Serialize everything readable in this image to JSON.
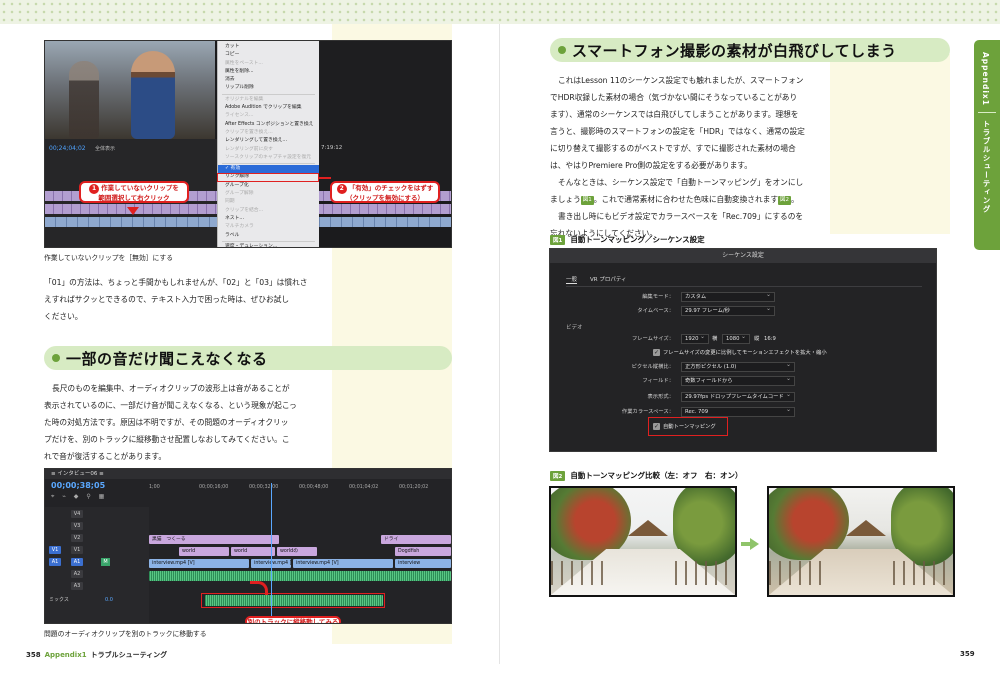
{
  "left": {
    "screenshot1": {
      "timecode": "00;24;04;02",
      "fit_label": "全体表示",
      "right_timecode": "7:19:12",
      "context_menu": [
        {
          "label": "カット",
          "state": "normal"
        },
        {
          "label": "コピー",
          "state": "normal"
        },
        {
          "label": "属性をペースト...",
          "state": "dim"
        },
        {
          "label": "属性を削除...",
          "state": "normal"
        },
        {
          "label": "消去",
          "state": "normal"
        },
        {
          "label": "リップル削除",
          "state": "normal"
        },
        {
          "label": "",
          "state": "sep"
        },
        {
          "label": "オリジナルを編集",
          "state": "dim"
        },
        {
          "label": "Adobe Audition でクリップを編集",
          "state": "normal"
        },
        {
          "label": "ライセンス...",
          "state": "dim"
        },
        {
          "label": "After Effects コンポジションと置き換え",
          "state": "normal"
        },
        {
          "label": "クリップを置き換え...",
          "state": "dim"
        },
        {
          "label": "レンダリングして置き換え...",
          "state": "normal"
        },
        {
          "label": "レンダリング前に戻す",
          "state": "dim"
        },
        {
          "label": "ソースクリップのキャプチャ設定を復元",
          "state": "dim"
        },
        {
          "label": "",
          "state": "sep"
        },
        {
          "label": "✓ 有効",
          "state": "hl"
        },
        {
          "label": "リンク解除",
          "state": "normal"
        },
        {
          "label": "グループ化",
          "state": "normal"
        },
        {
          "label": "グループ解除",
          "state": "dim"
        },
        {
          "label": "同期",
          "state": "dim"
        },
        {
          "label": "クリップを結合...",
          "state": "dim"
        },
        {
          "label": "ネスト...",
          "state": "normal"
        },
        {
          "label": "マルチカメラ",
          "state": "dim"
        },
        {
          "label": "ラベル",
          "state": "normal"
        },
        {
          "label": "",
          "state": "sep"
        },
        {
          "label": "速度・デュレーション...",
          "state": "normal"
        }
      ],
      "callout1_num": "1",
      "callout1_text": "作業していないクリップを\n範囲選択して右クリック",
      "callout2_num": "2",
      "callout2_text": "「有効」のチェックをはずす\n（クリップを無効にする）"
    },
    "caption1": "作業していないクリップを［無効］にする",
    "para1": [
      "「01」の方法は、ちょっと手間かもしれませんが、「02」と「03」は慣れさ",
      "えすればサクッとできるので、テキスト入力で困った時は、ぜひお試し",
      "ください。"
    ],
    "heading2": "一部の音だけ聞こえなくなる",
    "para2": [
      "長尺のものを編集中、オーディオクリップの波形上は音があることが",
      "表示されているのに、一部だけ音が聞こえなくなる、という現象が起こっ",
      "た時の対処方法です。原因は不明ですが、その問題のオーディオクリッ",
      "プだけを、別のトラックに縦移動させ配置しなおしてみてください。こ",
      "れで音が復活することがあります。"
    ],
    "screenshot2": {
      "tab": "≡ インタビュー06 ≡",
      "timecode": "00;00;38;05",
      "ruler": [
        "1;00",
        "00;00;16;00",
        "00;00;32;00",
        "00;00;48;00",
        "00;01;04;02",
        "00;01;20;02"
      ],
      "tracks": [
        "V4",
        "V3",
        "V2",
        "V1",
        "A1",
        "A2",
        "A3",
        "ミックス"
      ],
      "mix_value": "0.0",
      "clip_title": "黒猫　つくーる",
      "clip_title2": "ドライ",
      "clips_v2": [
        "world",
        "world",
        "worldの",
        "Dogdfish"
      ],
      "clip_v1": "interview.mp4 [V]",
      "clip_v1b": "interview.mp4 [V]",
      "clip_v1c": "interview.mp4 [V]",
      "clip_v1d": "interview",
      "callout": "別のトラックに縦移動してみる"
    },
    "caption2": "問題のオーディオクリップを別のトラックに移動する",
    "folio_num": "358",
    "folio_section": "Appendix1",
    "folio_title": "トラブルシューティング"
  },
  "right": {
    "heading": "スマートフォン撮影の素材が白飛びしてしまう",
    "para": [
      "これはLesson 11のシーケンス設定でも触れましたが、スマートフォン",
      "でHDR収録した素材の場合（気づかない間にそうなっていることがあり",
      "ます）、通常のシーケンスでは白飛びしてしまうことがあります。理想を",
      "言うと、撮影時のスマートフォンの設定を「HDR」ではなく、通常の設定",
      "に切り替えて撮影するのがベストですが、すでに撮影された素材の場合",
      "は、やはりPremiere Pro側の設定をする必要があります。"
    ],
    "para_b1": "そんなときは、シーケンス設定で「自動トーンマッピング」をオンにし",
    "para_b2a": "ましょう",
    "para_b2b": "。これで通常素材に合わせた色味に自動変換されます",
    "para_b2c": "。",
    "para_c": [
      "書き出し時にもビデオ設定でカラースペースを「Rec.709」にするのを",
      "忘れないようにしてください。"
    ],
    "fig1_badge": "図1",
    "fig2_badge": "図2",
    "fig1_title": "自動トーンマッピング／シーケンス設定",
    "dialog": {
      "title": "シーケンス設定",
      "tab_general": "一般",
      "tab_vr": "VR プロパティ",
      "edit_mode_label": "編集モード：",
      "edit_mode": "カスタム",
      "timebase_label": "タイムベース：",
      "timebase": "29.97 フレーム/秒",
      "video_group": "ビデオ",
      "frame_size_label": "フレームサイズ：",
      "frame_w": "1920",
      "frame_h_label": "横",
      "frame_h": "1080",
      "frame_v_label": "縦",
      "aspect": "16:9",
      "scale_chk": "フレームサイズの変更に比例してモーションエフェクトを拡大・縮小",
      "pixel_label": "ピクセル縦横比：",
      "pixel": "正方形ピクセル (1.0)",
      "field_label": "フィールド：",
      "field": "奇数フィールドから",
      "display_label": "表示形式：",
      "display": "29.97fps ドロップフレームタイムコード",
      "color_label": "作業カラースペース：",
      "color": "Rec. 709",
      "tone_chk": "自動トーンマッピング"
    },
    "fig2_title": "自動トーンマッピング比較（左：オフ　右：オン）",
    "side_tab_a": "Appendix1",
    "side_tab_b": "トラブルシューティング",
    "folio_num": "359"
  }
}
